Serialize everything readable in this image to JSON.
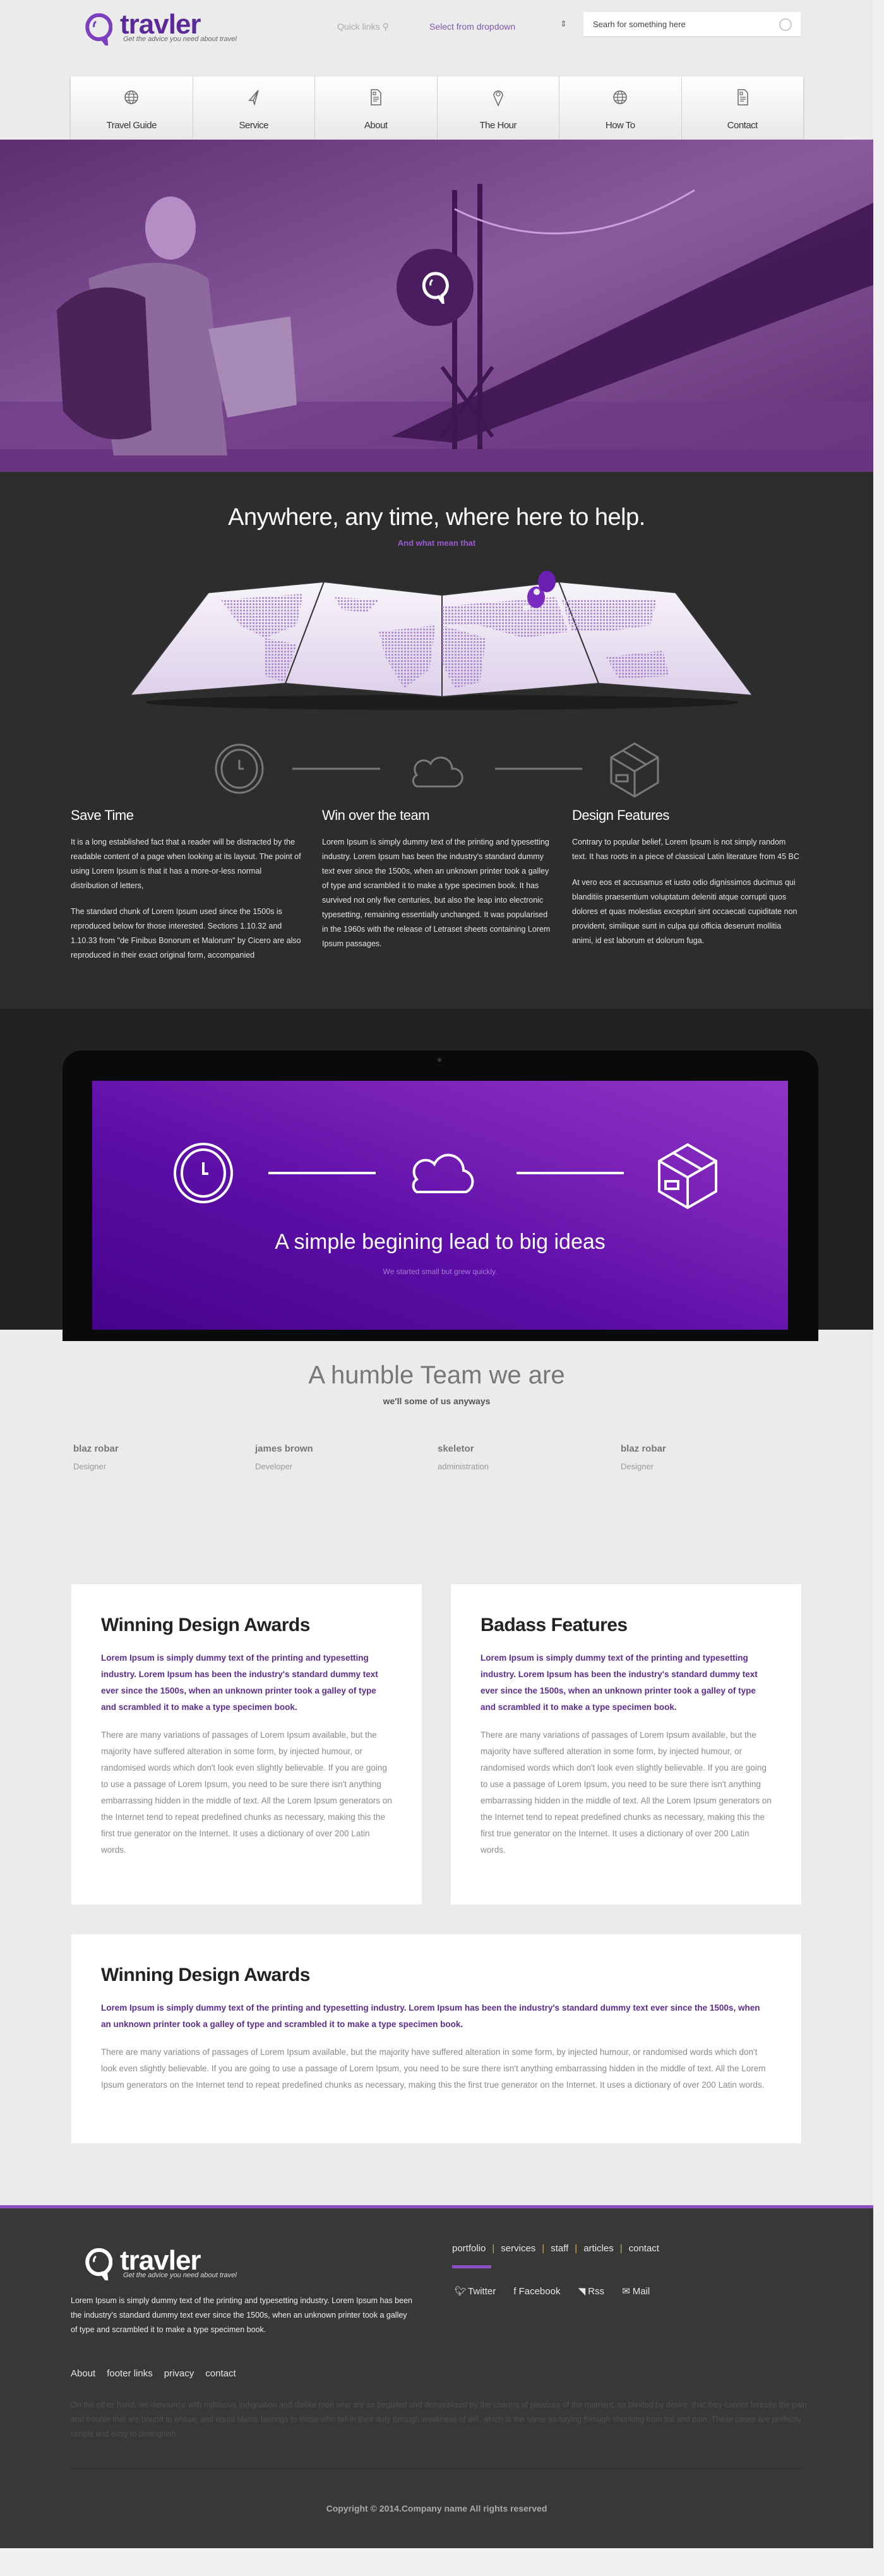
{
  "header": {
    "logo": "travler",
    "tagline": "Get the advice you need about travel",
    "quick_links": "Quick links",
    "select_value": "Select from dropdown",
    "search_placeholder": "Searh for something here"
  },
  "nav": [
    {
      "label": "Travel Guide",
      "icon": "globe-icon"
    },
    {
      "label": "Service",
      "icon": "paper-plane-icon"
    },
    {
      "label": "About",
      "icon": "document-icon"
    },
    {
      "label": "The Hour",
      "icon": "map-pin-icon"
    },
    {
      "label": "How To",
      "icon": "globe-icon"
    },
    {
      "label": "Contact",
      "icon": "document-icon"
    }
  ],
  "colors": {
    "accent": "#5f1da6",
    "purple_text": "#5e2e8f",
    "footer_border": "#8a4fc0"
  },
  "intro": {
    "title": "Anywhere, any time, where here to help.",
    "subtitle": "And what mean that",
    "columns": [
      {
        "title": "Save Time",
        "paragraphs": [
          "It is a long established fact that a reader will be distracted by the readable content of a page when looking at its layout. The point of using Lorem Ipsum is that it has a more-or-less normal distribution of letters,",
          "The standard chunk of Lorem Ipsum used since the 1500s is reproduced below for those interested. Sections 1.10.32 and 1.10.33 from \"de Finibus Bonorum et Malorum\" by Cicero are also reproduced in their exact original form, accompanied"
        ]
      },
      {
        "title": "Win over the team",
        "paragraphs": [
          "Lorem Ipsum is simply dummy text of the printing and typesetting industry. Lorem Ipsum has been the industry's standard dummy text ever since the 1500s, when an unknown printer took a galley of type and scrambled it to make a type specimen book. It has survived not only five centuries, but also the leap into electronic typesetting, remaining essentially unchanged. It was popularised in the 1960s with the release of Letraset sheets containing Lorem Ipsum passages."
        ]
      },
      {
        "title": "Design Features",
        "paragraphs": [
          "Contrary to popular belief, Lorem Ipsum is not simply random text. It has roots in a piece of classical Latin literature from 45 BC",
          "At vero eos et accusamus et iusto odio dignissimos ducimus qui blanditiis praesentium voluptatum deleniti atque corrupti quos dolores et quas molestias excepturi sint occaecati cupiditate non provident, similique sunt in culpa qui officia deserunt mollitia animi, id est laborum et dolorum fuga."
        ]
      }
    ]
  },
  "laptop": {
    "title": "A simple begining lead to big ideas",
    "subtitle": "We started small but grew quickly."
  },
  "team": {
    "title": "A humble Team we are",
    "subtitle": "we'll some of us anyways",
    "members": [
      {
        "name": "blaz robar",
        "role": "Designer"
      },
      {
        "name": "james brown",
        "role": "Developer"
      },
      {
        "name": "skeletor",
        "role": "administration"
      },
      {
        "name": "blaz robar",
        "role": "Designer"
      }
    ],
    "carousel_active": 1,
    "carousel_count": 3
  },
  "cards": [
    {
      "title": "Winning Design Awards",
      "lead": "Lorem Ipsum is simply dummy text of the printing and typesetting industry. Lorem Ipsum has been the industry's standard dummy text ever since the 1500s, when an unknown printer took a galley of type and scrambled it to make a type specimen book.",
      "body": "There are many variations of passages of Lorem Ipsum available, but the majority have suffered alteration in some form, by injected humour, or randomised words which don't look even slightly believable. If you are going to use a passage of Lorem Ipsum, you need to be sure there isn't anything embarrassing hidden in the middle of text. All the Lorem Ipsum generators on the Internet tend to repeat predefined chunks as necessary, making this the first true generator on the Internet. It uses a dictionary of over 200 Latin words."
    },
    {
      "title": "Badass Features",
      "lead": "Lorem Ipsum is simply dummy text of the printing and typesetting industry. Lorem Ipsum has been the industry's standard dummy text ever since the 1500s, when an unknown printer took a galley of type and scrambled it to make a type specimen book.",
      "body": "There are many variations of passages of Lorem Ipsum available, but the majority have suffered alteration in some form, by injected humour, or randomised words which don't look even slightly believable. If you are going to use a passage of Lorem Ipsum, you need to be sure there isn't anything embarrassing hidden in the middle of text. All the Lorem Ipsum generators on the Internet tend to repeat predefined chunks as necessary, making this the first true generator on the Internet. It uses a dictionary of over 200 Latin words."
    },
    {
      "title": "Winning Design Awards",
      "lead": "Lorem Ipsum is simply dummy text of the printing and typesetting industry. Lorem Ipsum has been the industry's standard dummy text ever since the 1500s, when an unknown printer took a galley of type and scrambled it to make a type specimen book.",
      "body": "There are many variations of passages of Lorem Ipsum available, but the majority have suffered alteration in some form, by injected humour, or randomised words which don't look even slightly believable. If you are going to use a passage of Lorem Ipsum, you need to be sure there isn't anything embarrassing hidden in the middle of text. All the Lorem Ipsum generators on the Internet tend to repeat predefined chunks as necessary, making this the first true generator on the Internet. It uses a dictionary of over 200 Latin words."
    }
  ],
  "footer": {
    "logo": "travler",
    "tagline": "Get the advice you need about travel",
    "text": "Lorem Ipsum is simply dummy text of the printing and typesetting industry. Lorem Ipsum has been the industry's standard dummy text ever since the 1500s, when an unknown printer took a galley of type and scrambled it to make a type specimen book.",
    "nav": [
      "portfolio",
      "services",
      "staff",
      "articles",
      "contact"
    ],
    "social": [
      "Twitter",
      "Facebook",
      "Rss",
      "Mail"
    ],
    "links": [
      "About",
      "footer links",
      "privacy",
      "contact"
    ],
    "paragraph": "On the other hand, we denounce with righteous indignation and dislike men who are so beguiled and demoralized by the charms of pleasure of the moment, so blinded by desire, that they cannot foresee the pain and trouble that are bound to ensue; and equal blame belongs to those who fail in their duty through weakness of will, which is the same as saying through shrinking from toil and pain. These cases are perfectly simple and easy to distinguish.",
    "copyright": "Copyright © 2014.Company name All rights reserved"
  }
}
